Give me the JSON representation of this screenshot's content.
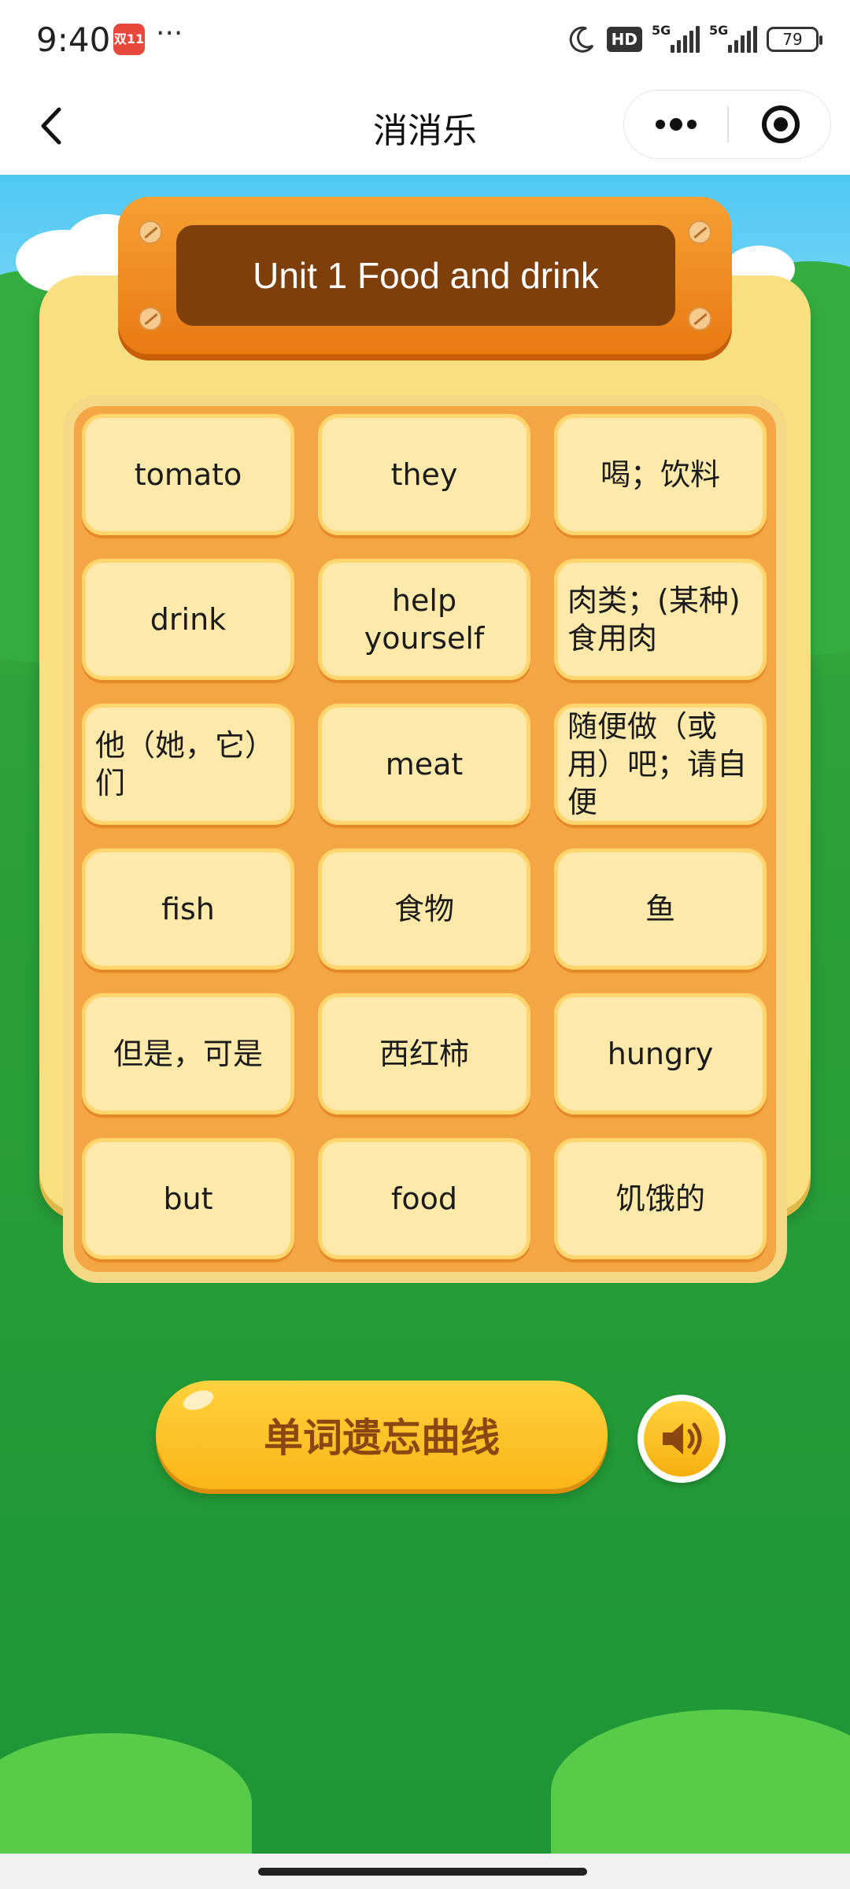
{
  "status_bar": {
    "time": "9:40",
    "app_badge": "双11",
    "dots": "···",
    "hd": "HD",
    "network_1": "5G",
    "network_2": "5G",
    "battery": "79"
  },
  "nav": {
    "title": "消消乐",
    "back_icon": "chevron-left-icon",
    "more_icon": "more-dots-icon",
    "close_icon": "target-close-icon"
  },
  "game": {
    "unit_title": "Unit 1 Food and drink",
    "cards": [
      {
        "text": "tomato"
      },
      {
        "text": "they"
      },
      {
        "text": "喝；饮料"
      },
      {
        "text": "drink"
      },
      {
        "text": "help yourself"
      },
      {
        "text": "肉类；(某种) 食用肉"
      },
      {
        "text": "他（她，它）们"
      },
      {
        "text": "meat"
      },
      {
        "text": "随便做（或用）吧；请自便"
      },
      {
        "text": "fish"
      },
      {
        "text": "食物"
      },
      {
        "text": "鱼"
      },
      {
        "text": "但是，可是"
      },
      {
        "text": "西红柿"
      },
      {
        "text": "hungry"
      },
      {
        "text": "but"
      },
      {
        "text": "food"
      },
      {
        "text": "饥饿的"
      }
    ],
    "action_button": "单词遗忘曲线",
    "sound_icon": "speaker-icon"
  },
  "colors": {
    "sky": "#4fc8f4",
    "grass": "#1e9636",
    "board": "#f8df7f",
    "grid": "#f4a644",
    "card": "#fde9a9",
    "plate": "#e87a10",
    "plate_inner": "#7e3f0b",
    "button": "#fbb617"
  }
}
